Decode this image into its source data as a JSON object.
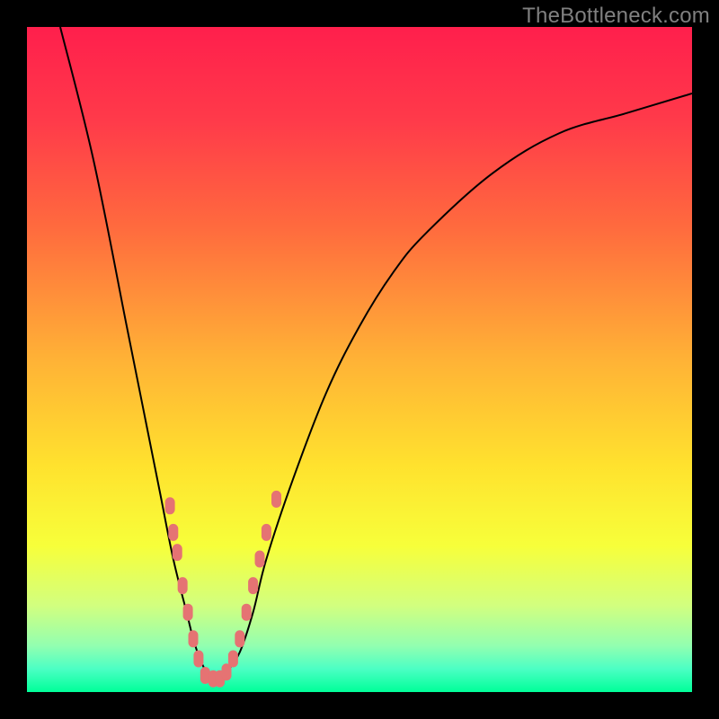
{
  "watermark": "TheBottleneck.com",
  "colors": {
    "frame": "#000000",
    "curve": "#000000",
    "marker": "#e57373",
    "gradient_stops": [
      {
        "offset": 0.0,
        "color": "#ff1f4c"
      },
      {
        "offset": 0.14,
        "color": "#ff3a4a"
      },
      {
        "offset": 0.3,
        "color": "#ff6a3e"
      },
      {
        "offset": 0.5,
        "color": "#ffb236"
      },
      {
        "offset": 0.66,
        "color": "#ffe22e"
      },
      {
        "offset": 0.78,
        "color": "#f7ff3a"
      },
      {
        "offset": 0.87,
        "color": "#d2ff7f"
      },
      {
        "offset": 0.93,
        "color": "#93ffb0"
      },
      {
        "offset": 0.965,
        "color": "#4cffc4"
      },
      {
        "offset": 1.0,
        "color": "#00ff99"
      }
    ]
  },
  "chart_data": {
    "type": "line",
    "title": "",
    "xlabel": "",
    "ylabel": "",
    "xlim": [
      0,
      100
    ],
    "ylim": [
      0,
      100
    ],
    "grid": false,
    "legend": false,
    "series": [
      {
        "name": "bottleneck-curve",
        "x": [
          5,
          10,
          15,
          18,
          20,
          22,
          24,
          25,
          26,
          27,
          28,
          29,
          30,
          32,
          34,
          36,
          40,
          45,
          50,
          55,
          60,
          70,
          80,
          90,
          100
        ],
        "y": [
          100,
          80,
          55,
          40,
          30,
          20,
          12,
          8,
          5,
          3,
          2,
          2,
          3,
          6,
          12,
          20,
          32,
          45,
          55,
          63,
          69,
          78,
          84,
          87,
          90
        ]
      }
    ],
    "markers": [
      {
        "x": 21.5,
        "y": 28,
        "r": 2.0
      },
      {
        "x": 22.0,
        "y": 24,
        "r": 2.0
      },
      {
        "x": 22.6,
        "y": 21,
        "r": 2.0
      },
      {
        "x": 23.4,
        "y": 16,
        "r": 2.0
      },
      {
        "x": 24.2,
        "y": 12,
        "r": 2.0
      },
      {
        "x": 25.0,
        "y": 8,
        "r": 2.0
      },
      {
        "x": 25.8,
        "y": 5,
        "r": 2.0
      },
      {
        "x": 26.8,
        "y": 2.5,
        "r": 2.0
      },
      {
        "x": 28.0,
        "y": 2.0,
        "r": 2.0
      },
      {
        "x": 29.0,
        "y": 2.0,
        "r": 2.0
      },
      {
        "x": 30.0,
        "y": 3.0,
        "r": 2.0
      },
      {
        "x": 31.0,
        "y": 5.0,
        "r": 2.0
      },
      {
        "x": 32.0,
        "y": 8.0,
        "r": 2.0
      },
      {
        "x": 33.0,
        "y": 12.0,
        "r": 2.0
      },
      {
        "x": 34.0,
        "y": 16.0,
        "r": 2.0
      },
      {
        "x": 35.0,
        "y": 20.0,
        "r": 2.0
      },
      {
        "x": 36.0,
        "y": 24.0,
        "r": 2.0
      },
      {
        "x": 37.5,
        "y": 29.0,
        "r": 2.0
      }
    ]
  }
}
